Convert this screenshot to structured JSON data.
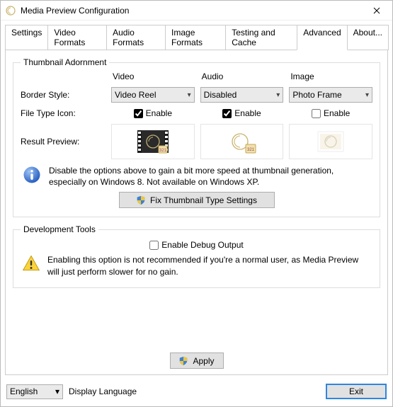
{
  "window": {
    "title": "Media Preview Configuration"
  },
  "tabs": {
    "items": [
      {
        "label": "Settings"
      },
      {
        "label": "Video Formats"
      },
      {
        "label": "Audio Formats"
      },
      {
        "label": "Image Formats"
      },
      {
        "label": "Testing and Cache"
      },
      {
        "label": "Advanced"
      },
      {
        "label": "About..."
      }
    ],
    "activeIndex": 5
  },
  "adornment": {
    "legend": "Thumbnail Adornment",
    "col_video": "Video",
    "col_audio": "Audio",
    "col_image": "Image",
    "row_border": "Border Style:",
    "row_icon": "File Type Icon:",
    "row_preview": "Result Preview:",
    "video_border": "Video Reel",
    "audio_border": "Disabled",
    "image_border": "Photo Frame",
    "enable_label": "Enable",
    "video_enable": true,
    "audio_enable": true,
    "image_enable": false,
    "info_text": "Disable the options above to gain a bit more speed at thumbnail generation, especially on Windows 8. Not available on Windows XP.",
    "fix_label": "Fix Thumbnail Type Settings"
  },
  "dev": {
    "legend": "Development Tools",
    "debug_label": "Enable Debug Output",
    "debug_checked": false,
    "warn_text": "Enabling this option is not recommended if you're a normal user, as Media Preview will just perform slower for no gain."
  },
  "buttons": {
    "apply": "Apply",
    "exit": "Exit"
  },
  "footer": {
    "language_selected": "English",
    "language_label": "Display Language"
  }
}
